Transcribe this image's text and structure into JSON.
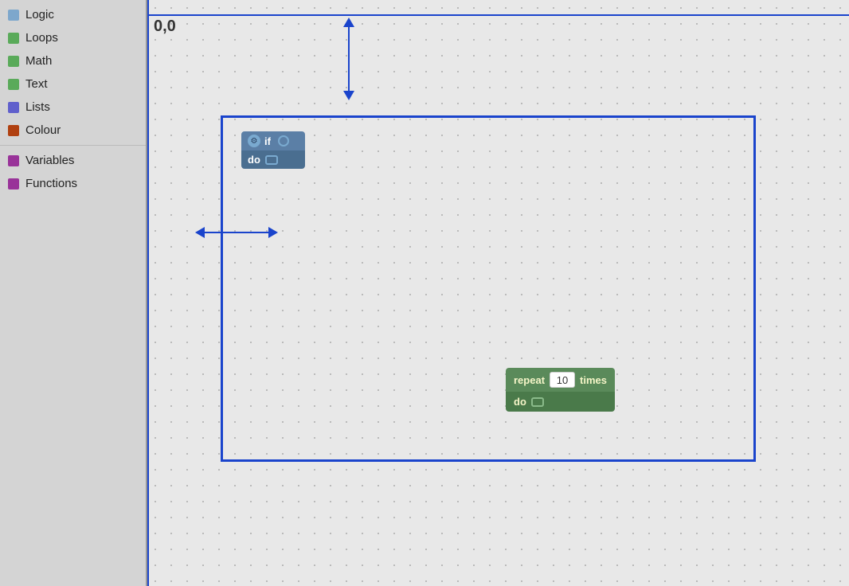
{
  "sidebar": {
    "items": [
      {
        "id": "logic",
        "label": "Logic",
        "color": "#7da7cc"
      },
      {
        "id": "loops",
        "label": "Loops",
        "color": "#5aaa5a"
      },
      {
        "id": "math",
        "label": "Math",
        "color": "#5aaa5a"
      },
      {
        "id": "text",
        "label": "Text",
        "color": "#5aaa5a"
      },
      {
        "id": "lists",
        "label": "Lists",
        "color": "#6060cc"
      },
      {
        "id": "colour",
        "label": "Colour",
        "color": "#b04010"
      },
      {
        "id": "variables",
        "label": "Variables",
        "color": "#993399"
      },
      {
        "id": "functions",
        "label": "Functions",
        "color": "#993399"
      }
    ]
  },
  "canvas": {
    "coords": "0,0"
  },
  "blocks": {
    "if_block": {
      "if_label": "if",
      "do_label": "do"
    },
    "repeat_block": {
      "repeat_label": "repeat",
      "times_value": "10",
      "times_label": "times",
      "do_label": "do"
    }
  }
}
